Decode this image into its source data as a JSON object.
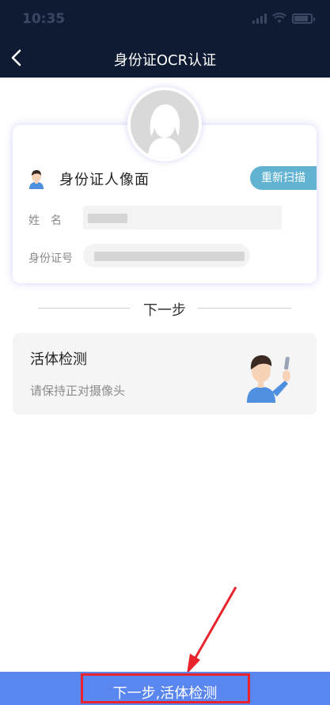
{
  "status_bar": {
    "time": "10:35"
  },
  "header": {
    "title": "身份证OCR认证"
  },
  "id_card": {
    "section_title": "身份证人像面",
    "rescan_label": "重新扫描",
    "fields": [
      {
        "label": "姓　名"
      },
      {
        "label": "身份证号"
      }
    ]
  },
  "divider": {
    "label": "下一步"
  },
  "liveness": {
    "title": "活体检测",
    "subtitle": "请保持正对摄像头"
  },
  "bottom_button": {
    "label": "下一步,活体检测"
  },
  "colors": {
    "header_bg": "#0f1b33",
    "accent": "#5a86f0",
    "rescan_bg": "#61b3d1",
    "annotation": "#e8232b"
  }
}
